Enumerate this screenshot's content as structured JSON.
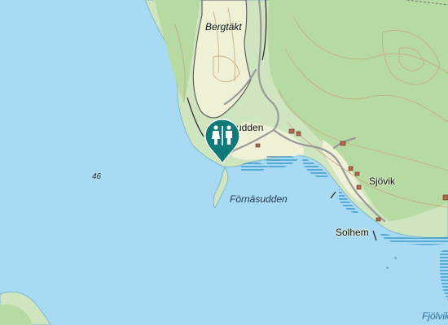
{
  "map": {
    "colors": {
      "water": "#a9daf4",
      "land": "#cfe5bf",
      "forest": "#b7d9a2",
      "open_land": "#eef1d6",
      "road": "#9a9a9a",
      "contour": "#c9a97a",
      "shore_hatch": "#2a8fc0",
      "marker": "#0f7a78"
    },
    "labels": {
      "bergtakt": "Bergtäkt",
      "udden": "udden",
      "fornasudden": "Förnäsudden",
      "sjovik": "Sjövik",
      "solhem": "Solhem",
      "fjolvik": "Fjölvik",
      "depth": "46"
    },
    "marker": {
      "icon": "toilet-icon",
      "type": "public toilet"
    }
  }
}
